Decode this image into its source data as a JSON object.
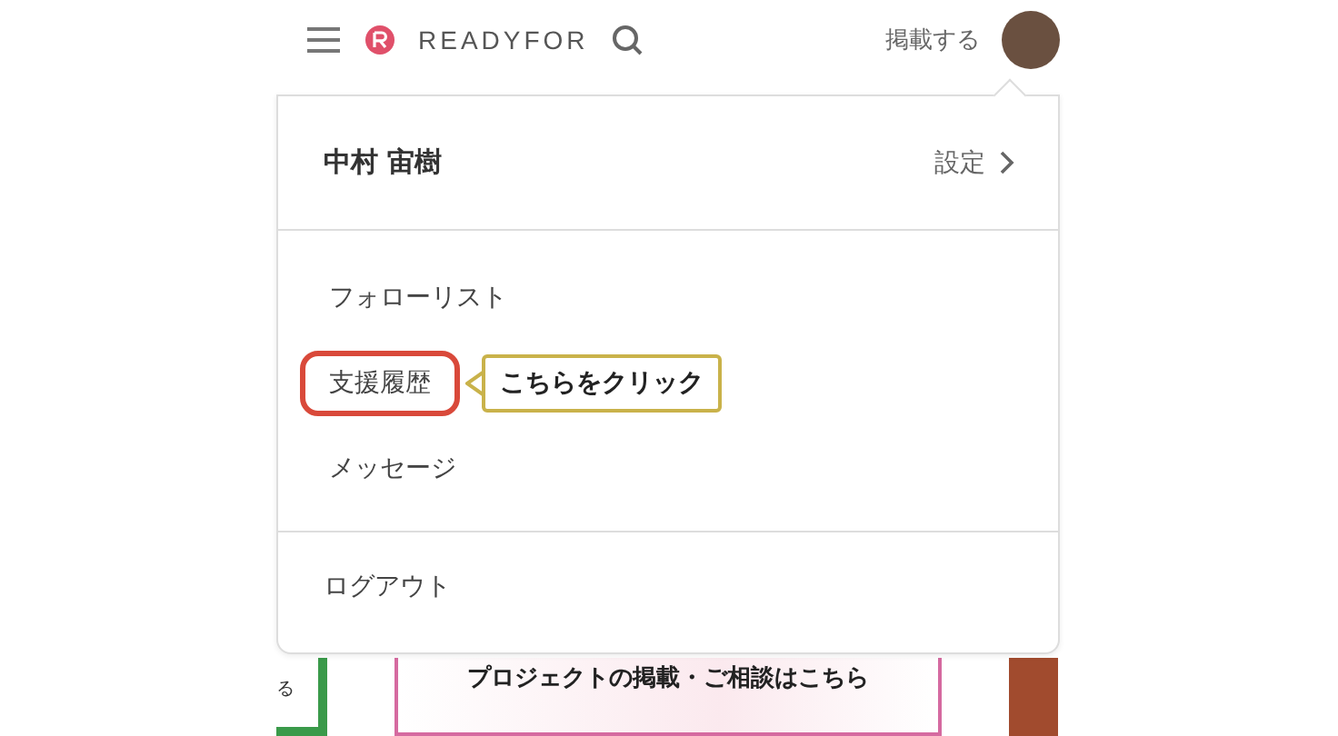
{
  "header": {
    "logo_text": "READYFOR",
    "post_link": "掲載する"
  },
  "menu": {
    "user_name": "中村 宙樹",
    "settings_link": "設定",
    "items": [
      {
        "label": "フォローリスト",
        "highlighted": false
      },
      {
        "label": "支援履歴",
        "highlighted": true
      },
      {
        "label": "メッセージ",
        "highlighted": false
      }
    ],
    "callout": "こちらをクリック",
    "logout": "ログアウト"
  },
  "banners": {
    "left_fragment": "る",
    "center_text": "プロジェクトの掲載・ご相談はこちら"
  }
}
